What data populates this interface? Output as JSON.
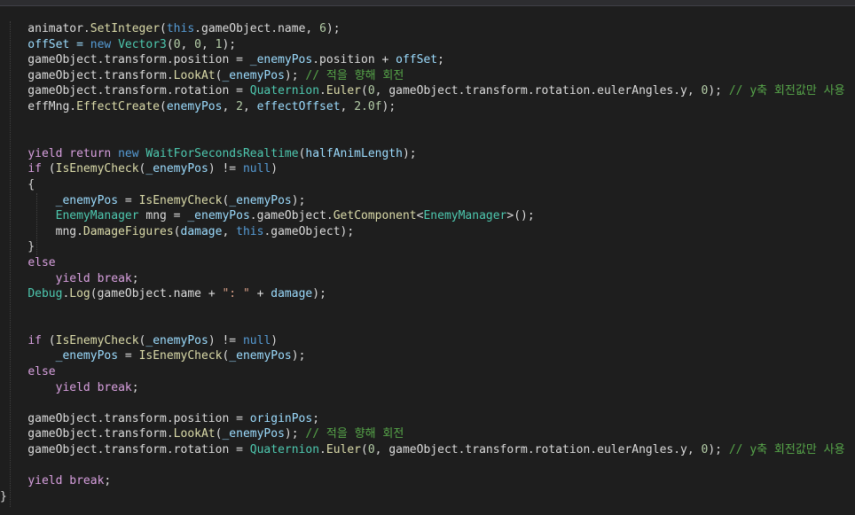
{
  "editor": {
    "background": "#1e1e1e",
    "lines": [
      [
        {
          "t": "    animator.",
          "c": "plain"
        },
        {
          "t": "SetInteger",
          "c": "method"
        },
        {
          "t": "(",
          "c": "plain"
        },
        {
          "t": "this",
          "c": "keyword"
        },
        {
          "t": ".gameObject.name, ",
          "c": "plain"
        },
        {
          "t": "6",
          "c": "number"
        },
        {
          "t": ");",
          "c": "plain"
        }
      ],
      [
        {
          "t": "    offSet = ",
          "c": "param"
        },
        {
          "t": "new ",
          "c": "keyword"
        },
        {
          "t": "Vector3",
          "c": "type"
        },
        {
          "t": "(",
          "c": "plain"
        },
        {
          "t": "0",
          "c": "number"
        },
        {
          "t": ", ",
          "c": "plain"
        },
        {
          "t": "0",
          "c": "number"
        },
        {
          "t": ", ",
          "c": "plain"
        },
        {
          "t": "1",
          "c": "number"
        },
        {
          "t": ");",
          "c": "plain"
        }
      ],
      [
        {
          "t": "    gameObject.transform.position = ",
          "c": "plain"
        },
        {
          "t": "_enemyPos",
          "c": "param"
        },
        {
          "t": ".position + ",
          "c": "plain"
        },
        {
          "t": "offSet",
          "c": "param"
        },
        {
          "t": ";",
          "c": "plain"
        }
      ],
      [
        {
          "t": "    gameObject.transform.",
          "c": "plain"
        },
        {
          "t": "LookAt",
          "c": "method"
        },
        {
          "t": "(",
          "c": "plain"
        },
        {
          "t": "_enemyPos",
          "c": "param"
        },
        {
          "t": "); ",
          "c": "plain"
        },
        {
          "t": "// 적을 향해 회전",
          "c": "comment"
        }
      ],
      [
        {
          "t": "    gameObject.transform.rotation = ",
          "c": "plain"
        },
        {
          "t": "Quaternion",
          "c": "type"
        },
        {
          "t": ".",
          "c": "plain"
        },
        {
          "t": "Euler",
          "c": "method"
        },
        {
          "t": "(",
          "c": "plain"
        },
        {
          "t": "0",
          "c": "number"
        },
        {
          "t": ", gameObject.transform.rotation.eulerAngles.y, ",
          "c": "plain"
        },
        {
          "t": "0",
          "c": "number"
        },
        {
          "t": "); ",
          "c": "plain"
        },
        {
          "t": "// y축 회전값만 사용",
          "c": "comment"
        }
      ],
      [
        {
          "t": "    effMng.",
          "c": "plain"
        },
        {
          "t": "EffectCreate",
          "c": "method"
        },
        {
          "t": "(",
          "c": "plain"
        },
        {
          "t": "enemyPos",
          "c": "param"
        },
        {
          "t": ", ",
          "c": "plain"
        },
        {
          "t": "2",
          "c": "number"
        },
        {
          "t": ", ",
          "c": "plain"
        },
        {
          "t": "effectOffset",
          "c": "param"
        },
        {
          "t": ", ",
          "c": "plain"
        },
        {
          "t": "2.0f",
          "c": "number"
        },
        {
          "t": ");",
          "c": "plain"
        }
      ],
      [],
      [],
      [
        {
          "t": "    ",
          "c": "plain"
        },
        {
          "t": "yield return ",
          "c": "control"
        },
        {
          "t": "new ",
          "c": "keyword"
        },
        {
          "t": "WaitForSecondsRealtime",
          "c": "type"
        },
        {
          "t": "(",
          "c": "plain"
        },
        {
          "t": "halfAnimLength",
          "c": "param"
        },
        {
          "t": ");",
          "c": "plain"
        }
      ],
      [
        {
          "t": "    ",
          "c": "plain"
        },
        {
          "t": "if ",
          "c": "control"
        },
        {
          "t": "(",
          "c": "plain"
        },
        {
          "t": "IsEnemyCheck",
          "c": "method"
        },
        {
          "t": "(",
          "c": "plain"
        },
        {
          "t": "_enemyPos",
          "c": "param"
        },
        {
          "t": ") != ",
          "c": "plain"
        },
        {
          "t": "null",
          "c": "keyword"
        },
        {
          "t": ")",
          "c": "plain"
        }
      ],
      [
        {
          "t": "    {",
          "c": "plain"
        }
      ],
      [
        {
          "t": "        ",
          "c": "plain"
        },
        {
          "t": "_enemyPos",
          "c": "param"
        },
        {
          "t": " = ",
          "c": "plain"
        },
        {
          "t": "IsEnemyCheck",
          "c": "method"
        },
        {
          "t": "(",
          "c": "plain"
        },
        {
          "t": "_enemyPos",
          "c": "param"
        },
        {
          "t": ");",
          "c": "plain"
        }
      ],
      [
        {
          "t": "        ",
          "c": "plain"
        },
        {
          "t": "EnemyManager",
          "c": "type"
        },
        {
          "t": " mng = ",
          "c": "plain"
        },
        {
          "t": "_enemyPos",
          "c": "param"
        },
        {
          "t": ".gameObject.",
          "c": "plain"
        },
        {
          "t": "GetComponent",
          "c": "method"
        },
        {
          "t": "<",
          "c": "plain"
        },
        {
          "t": "EnemyManager",
          "c": "type"
        },
        {
          "t": ">();",
          "c": "plain"
        }
      ],
      [
        {
          "t": "        mng.",
          "c": "plain"
        },
        {
          "t": "DamageFigures",
          "c": "method"
        },
        {
          "t": "(",
          "c": "plain"
        },
        {
          "t": "damage",
          "c": "param"
        },
        {
          "t": ", ",
          "c": "plain"
        },
        {
          "t": "this",
          "c": "keyword"
        },
        {
          "t": ".gameObject);",
          "c": "plain"
        }
      ],
      [
        {
          "t": "    }",
          "c": "plain"
        }
      ],
      [
        {
          "t": "    ",
          "c": "plain"
        },
        {
          "t": "else",
          "c": "control"
        }
      ],
      [
        {
          "t": "        ",
          "c": "plain"
        },
        {
          "t": "yield break",
          "c": "control"
        },
        {
          "t": ";",
          "c": "plain"
        }
      ],
      [
        {
          "t": "    ",
          "c": "plain"
        },
        {
          "t": "Debug",
          "c": "type"
        },
        {
          "t": ".",
          "c": "plain"
        },
        {
          "t": "Log",
          "c": "method"
        },
        {
          "t": "(gameObject.name + ",
          "c": "plain"
        },
        {
          "t": "\": \"",
          "c": "string"
        },
        {
          "t": " + ",
          "c": "plain"
        },
        {
          "t": "damage",
          "c": "param"
        },
        {
          "t": ");",
          "c": "plain"
        }
      ],
      [],
      [],
      [
        {
          "t": "    ",
          "c": "plain"
        },
        {
          "t": "if ",
          "c": "control"
        },
        {
          "t": "(",
          "c": "plain"
        },
        {
          "t": "IsEnemyCheck",
          "c": "method"
        },
        {
          "t": "(",
          "c": "plain"
        },
        {
          "t": "_enemyPos",
          "c": "param"
        },
        {
          "t": ") != ",
          "c": "plain"
        },
        {
          "t": "null",
          "c": "keyword"
        },
        {
          "t": ")",
          "c": "plain"
        }
      ],
      [
        {
          "t": "        ",
          "c": "plain"
        },
        {
          "t": "_enemyPos",
          "c": "param"
        },
        {
          "t": " = ",
          "c": "plain"
        },
        {
          "t": "IsEnemyCheck",
          "c": "method"
        },
        {
          "t": "(",
          "c": "plain"
        },
        {
          "t": "_enemyPos",
          "c": "param"
        },
        {
          "t": ");",
          "c": "plain"
        }
      ],
      [
        {
          "t": "    ",
          "c": "plain"
        },
        {
          "t": "else",
          "c": "control"
        }
      ],
      [
        {
          "t": "        ",
          "c": "plain"
        },
        {
          "t": "yield break",
          "c": "control"
        },
        {
          "t": ";",
          "c": "plain"
        }
      ],
      [],
      [
        {
          "t": "    gameObject.transform.position = ",
          "c": "plain"
        },
        {
          "t": "originPos",
          "c": "param"
        },
        {
          "t": ";",
          "c": "plain"
        }
      ],
      [
        {
          "t": "    gameObject.transform.",
          "c": "plain"
        },
        {
          "t": "LookAt",
          "c": "method"
        },
        {
          "t": "(",
          "c": "plain"
        },
        {
          "t": "_enemyPos",
          "c": "param"
        },
        {
          "t": "); ",
          "c": "plain"
        },
        {
          "t": "// 적을 향해 회전",
          "c": "comment"
        }
      ],
      [
        {
          "t": "    gameObject.transform.rotation = ",
          "c": "plain"
        },
        {
          "t": "Quaternion",
          "c": "type"
        },
        {
          "t": ".",
          "c": "plain"
        },
        {
          "t": "Euler",
          "c": "method"
        },
        {
          "t": "(",
          "c": "plain"
        },
        {
          "t": "0",
          "c": "number"
        },
        {
          "t": ", gameObject.transform.rotation.eulerAngles.y, ",
          "c": "plain"
        },
        {
          "t": "0",
          "c": "number"
        },
        {
          "t": "); ",
          "c": "plain"
        },
        {
          "t": "// y축 회전값만 사용",
          "c": "comment"
        }
      ],
      [],
      [
        {
          "t": "    ",
          "c": "plain"
        },
        {
          "t": "yield break",
          "c": "control"
        },
        {
          "t": ";",
          "c": "plain"
        }
      ],
      [
        {
          "t": "}",
          "c": "plain"
        }
      ]
    ]
  }
}
